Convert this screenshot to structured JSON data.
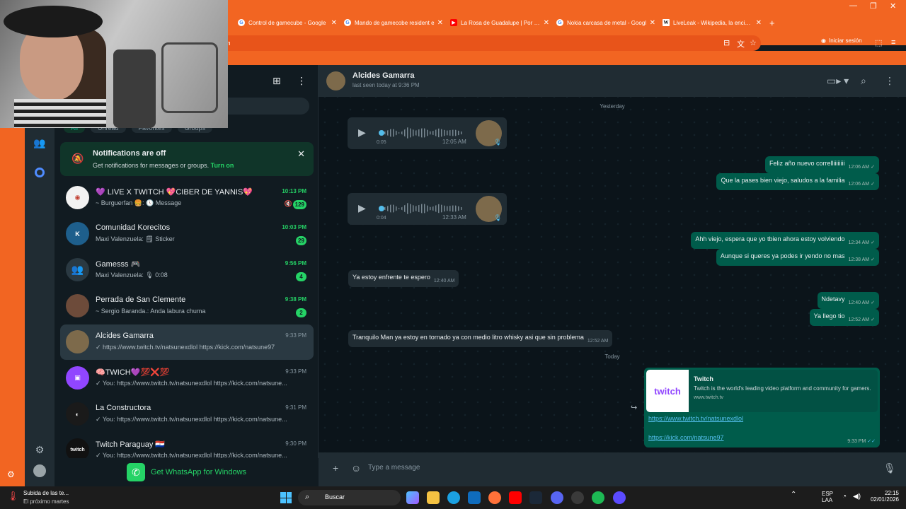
{
  "browser": {
    "tabs": [
      {
        "title": "Control de gamecube - Google",
        "icon": "google-icon"
      },
      {
        "title": "Mando de gamecobe resident e",
        "icon": "google-icon"
      },
      {
        "title": "La Rosa de Guadalupe | Por Sie",
        "icon": "youtube-icon"
      },
      {
        "title": "Nokia carcasa de metal - Googl",
        "icon": "google-icon"
      },
      {
        "title": "LiveLeak - Wikipedia, la enciclop",
        "icon": "wikipedia-icon"
      }
    ],
    "new_tab": "+",
    "address_tail": "m",
    "signin_label": "Iniciar sesión"
  },
  "sidebar": {
    "filters": [
      "All",
      "Unread",
      "Favorites",
      "Groups"
    ],
    "notification": {
      "title": "Notifications are off",
      "subtitle": "Get notifications for messages or groups.",
      "action": "Turn on"
    },
    "chats": [
      {
        "name": "💜 LIVE X TWITCH 💖CIBER DE YANNIS💖",
        "preview": "~ Burguerfan 🍔: 🕔 Message",
        "time": "10:13 PM",
        "unread": "129",
        "muted": true
      },
      {
        "name": "Comunidad Korecitos",
        "preview": "Maxi Valenzuela: 🗒 Sticker",
        "time": "10:03 PM",
        "unread": "29"
      },
      {
        "name": "Gamesss 🎮",
        "preview": "Maxi Valenzuela: 🎙 0:08",
        "time": "9:56 PM",
        "unread": "4"
      },
      {
        "name": "Perrada de San Clemente",
        "preview": "~ Sergio Baranda.: Anda labura chuma",
        "time": "9:38 PM",
        "unread": "2"
      },
      {
        "name": "Alcides Gamarra",
        "preview": "✓ https://www.twitch.tv/natsunexdlol https://kick.com/natsune97",
        "time": "9:33 PM",
        "selected": true
      },
      {
        "name": "🧠TWICH💜💯❌💯",
        "preview": "✓ You: https://www.twitch.tv/natsunexdlol https://kick.com/natsune...",
        "time": "9:33 PM"
      },
      {
        "name": "La Constructora",
        "preview": "✓ You: https://www.twitch.tv/natsunexdlol https://kick.com/natsune...",
        "time": "9:31 PM"
      },
      {
        "name": "Twitch Paraguay 🇵🇾",
        "preview": "✓ You: https://www.twitch.tv/natsunexdlol https://kick.com/natsune...",
        "time": "9:30 PM"
      }
    ],
    "get_app": "Get WhatsApp for Windows"
  },
  "conversation": {
    "contact_name": "Alcides Gamarra",
    "status": "last seen today at 9:36 PM",
    "day_yesterday": "Yesterday",
    "day_today": "Today",
    "voice": [
      {
        "duration": "0:05",
        "time": "12:05 AM"
      },
      {
        "duration": "0:04",
        "time": "12:33 AM"
      }
    ],
    "messages": [
      {
        "text": "Feliz año nuevo correlliiiiiiii",
        "time": "12:06 AM",
        "dir": "out"
      },
      {
        "text": "Que la pases bien viejo, saludos a la familia",
        "time": "12:06 AM",
        "dir": "out"
      },
      {
        "text": "Ahh viejo, espera que yo tbien ahora estoy volviendo",
        "time": "12:34 AM",
        "dir": "out"
      },
      {
        "text": "Aunque si queres ya podes ir yendo no mas",
        "time": "12:38 AM",
        "dir": "out"
      },
      {
        "text": "Ya estoy enfrente te espero",
        "time": "12:40 AM",
        "dir": "in"
      },
      {
        "text": "Ndetavy",
        "time": "12:40 AM",
        "dir": "out"
      },
      {
        "text": "Ya llego tio",
        "time": "12:52 AM",
        "dir": "out"
      },
      {
        "text": "Tranquilo Man ya estoy en tornado ya con medio litro whisky asi que sin problema",
        "time": "12:52 AM",
        "dir": "in"
      }
    ],
    "link_preview": {
      "title": "Twitch",
      "description": "Twitch is the world's leading video platform and community for gamers.",
      "domain": "www.twitch.tv",
      "logo_text": "twitch",
      "url1": "https://www.twitch.tv/natsunexdlol",
      "url2": "https://kick.com/natsune97",
      "time": "9:33 PM"
    },
    "composer_placeholder": "Type a message"
  },
  "taskbar": {
    "weather_title": "Subida de las te...",
    "weather_sub": "El próximo martes",
    "search_label": "Buscar",
    "lang1": "ESP",
    "lang2": "LAA",
    "time": "22:15",
    "date": "02/01/2026"
  },
  "colors": {
    "browser_orange": "#f26522",
    "wa_green": "#25d366",
    "outgoing_bubble": "#005c4b",
    "incoming_bubble": "#202c33"
  }
}
